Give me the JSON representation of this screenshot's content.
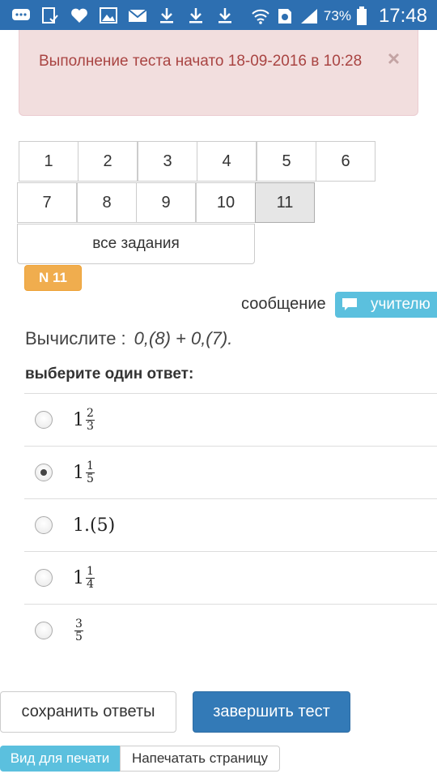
{
  "status_bar": {
    "battery_percent": "73%",
    "time": "17:48",
    "icons": [
      "chat-icon",
      "checklist-icon",
      "heart-icon",
      "image-icon",
      "mail-icon",
      "download-icon",
      "download-icon",
      "download-icon",
      "wifi-icon",
      "sim-icon",
      "signal-icon",
      "battery-icon"
    ]
  },
  "alert": {
    "text": "Выполнение теста начато 18-09-2016 в 10:28",
    "close": "×"
  },
  "tasks": {
    "items": [
      "1",
      "2",
      "3",
      "4",
      "5",
      "6",
      "7",
      "8",
      "9",
      "10",
      "11"
    ],
    "active": "11",
    "all_label": "все задания"
  },
  "badge": "N 11",
  "message": {
    "label": "сообщение",
    "button": "учителю"
  },
  "question": {
    "prompt": "Вычислите :",
    "expression": "0,(8) + 0,(7)."
  },
  "choose_label": "выберите один ответ:",
  "answers": [
    {
      "whole": "1",
      "num": "2",
      "den": "3",
      "text": "",
      "checked": false
    },
    {
      "whole": "1",
      "num": "1",
      "den": "5",
      "text": "",
      "checked": true
    },
    {
      "whole": "",
      "num": "",
      "den": "",
      "text": "1.(5)",
      "checked": false
    },
    {
      "whole": "1",
      "num": "1",
      "den": "4",
      "text": "",
      "checked": false
    },
    {
      "whole": "",
      "num": "3",
      "den": "5",
      "text": "",
      "checked": false
    }
  ],
  "buttons": {
    "save": "сохранить ответы",
    "finish": "завершить тест",
    "print_view": "Вид для печати",
    "print_page": "Напечатать страницу"
  },
  "colors": {
    "status_bar": "#2d6fb1",
    "alert_bg": "#f2dede",
    "alert_text": "#a94442",
    "badge": "#f0ad4e",
    "info": "#5bc0de",
    "primary": "#337ab7"
  }
}
